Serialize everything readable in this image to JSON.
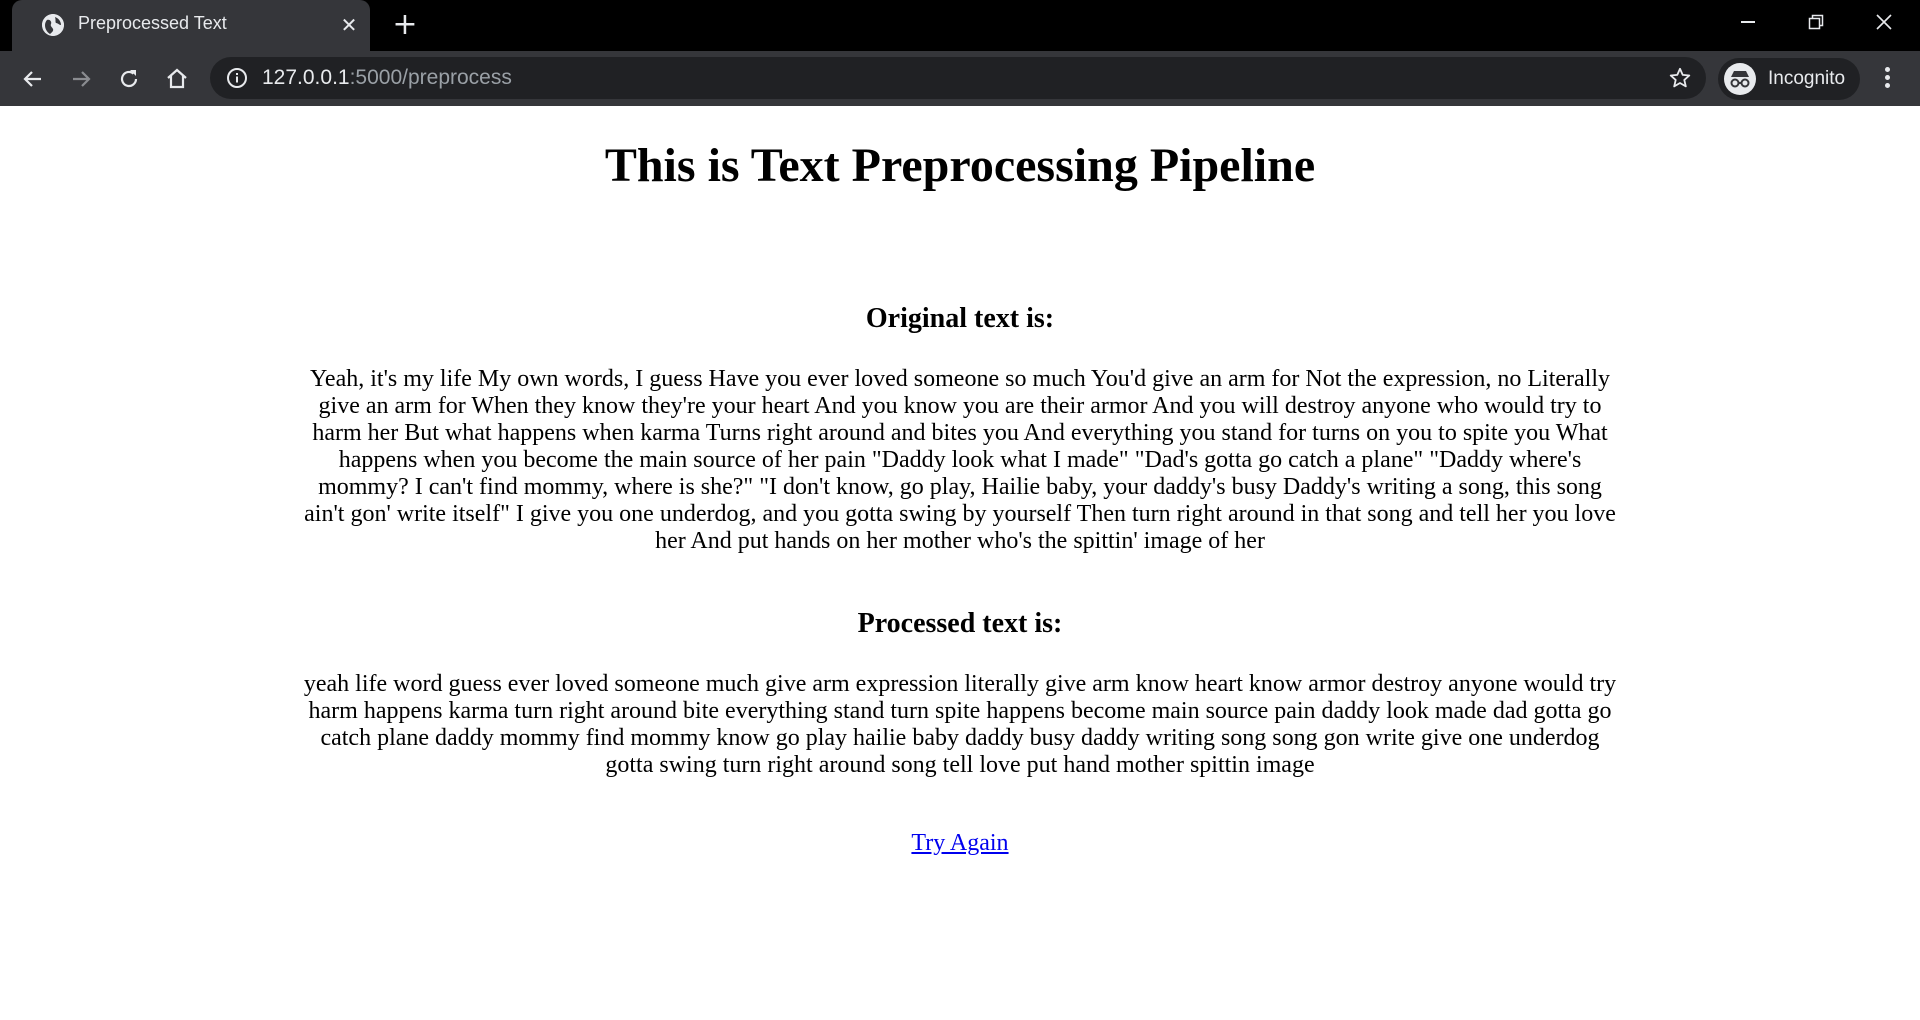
{
  "browser": {
    "tab": {
      "title": "Preprocessed Text",
      "favicon": "globe-icon",
      "close": "close-icon"
    },
    "new_tab": "plus-icon",
    "window_controls": [
      "minimize-icon",
      "restore-icon",
      "close-icon"
    ],
    "toolbar": {
      "nav": [
        "back-arrow-icon",
        "forward-arrow-icon",
        "reload-icon",
        "home-icon"
      ],
      "address": {
        "host": "127.0.0.1",
        "path": ":5000/preprocess"
      },
      "bookmark": "star-icon",
      "profile_label": "Incognito",
      "menu": "more-vertical-icon"
    },
    "colors": {
      "titlebar": "#000000",
      "toolbar": "#35363a",
      "omnibox": "#202124",
      "link": "#0000ee"
    }
  },
  "page": {
    "title": "This is Text Preprocessing Pipeline",
    "original_heading": "Original text is:",
    "original_text": "Yeah, it's my life My own words, I guess Have you ever loved someone so much You'd give an arm for Not the expression, no Literally give an arm for When they know they're your heart And you know you are their armor And you will destroy anyone who would try to harm her But what happens when karma Turns right around and bites you And everything you stand for turns on you to spite you What happens when you become the main source of her pain \"Daddy look what I made\" \"Dad's gotta go catch a plane\" \"Daddy where's mommy? I can't find mommy, where is she?\" \"I don't know, go play, Hailie baby, your daddy's busy Daddy's writing a song, this song ain't gon' write itself\" I give you one underdog, and you gotta swing by yourself Then turn right around in that song and tell her you love her And put hands on her mother who's the spittin' image of her",
    "processed_heading": "Processed text is:",
    "processed_text": "yeah life word guess ever loved someone much give arm expression literally give arm know heart know armor destroy anyone would try harm happens karma turn right around bite everything stand turn spite happens become main source pain daddy look made dad gotta go catch plane daddy mommy find mommy know go play hailie baby daddy busy daddy writing song song gon write give one underdog gotta swing turn right around song tell love put hand mother spittin image",
    "try_again_label": "Try Again"
  }
}
